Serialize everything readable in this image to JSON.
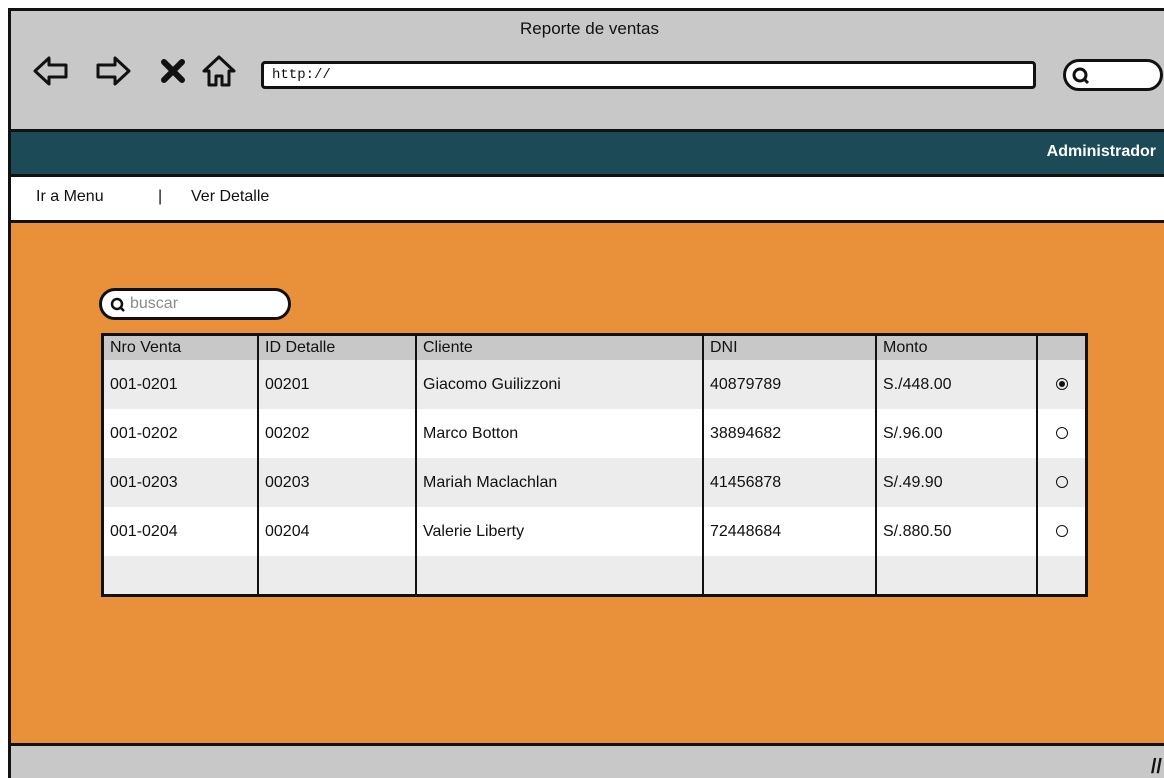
{
  "window": {
    "title": "Reporte de ventas"
  },
  "browser": {
    "url": "http://",
    "icons": [
      "back-arrow-icon",
      "forward-arrow-icon",
      "close-icon",
      "home-icon",
      "search-icon"
    ]
  },
  "header": {
    "user_label": "Administrador"
  },
  "menu": {
    "item1": "Ir a Menu",
    "separator": "|",
    "item2": "Ver Detalle"
  },
  "search": {
    "placeholder": "buscar",
    "value": ""
  },
  "table": {
    "headers": [
      "Nro Venta",
      "ID Detalle",
      "Cliente",
      "DNI",
      "Monto",
      ""
    ],
    "rows": [
      {
        "nro_venta": "001-0201",
        "id_detalle": "00201",
        "cliente": "Giacomo Guilizzoni",
        "dni": "40879789",
        "monto": "S./448.00",
        "selected": true
      },
      {
        "nro_venta": "001-0202",
        "id_detalle": "00202",
        "cliente": "Marco Botton",
        "dni": "38894682",
        "monto": "S/.96.00",
        "selected": false
      },
      {
        "nro_venta": "001-0203",
        "id_detalle": "00203",
        "cliente": "Mariah Maclachlan",
        "dni": "41456878",
        "monto": "S/.49.90",
        "selected": false
      },
      {
        "nro_venta": "001-0204",
        "id_detalle": "00204",
        "cliente": "Valerie Liberty",
        "dni": "72448684",
        "monto": "S/.880.50",
        "selected": false
      }
    ]
  },
  "colors": {
    "header_bg": "#1c4b57",
    "content_bg": "#e8913a",
    "chrome_bg": "#c8c8c8"
  }
}
